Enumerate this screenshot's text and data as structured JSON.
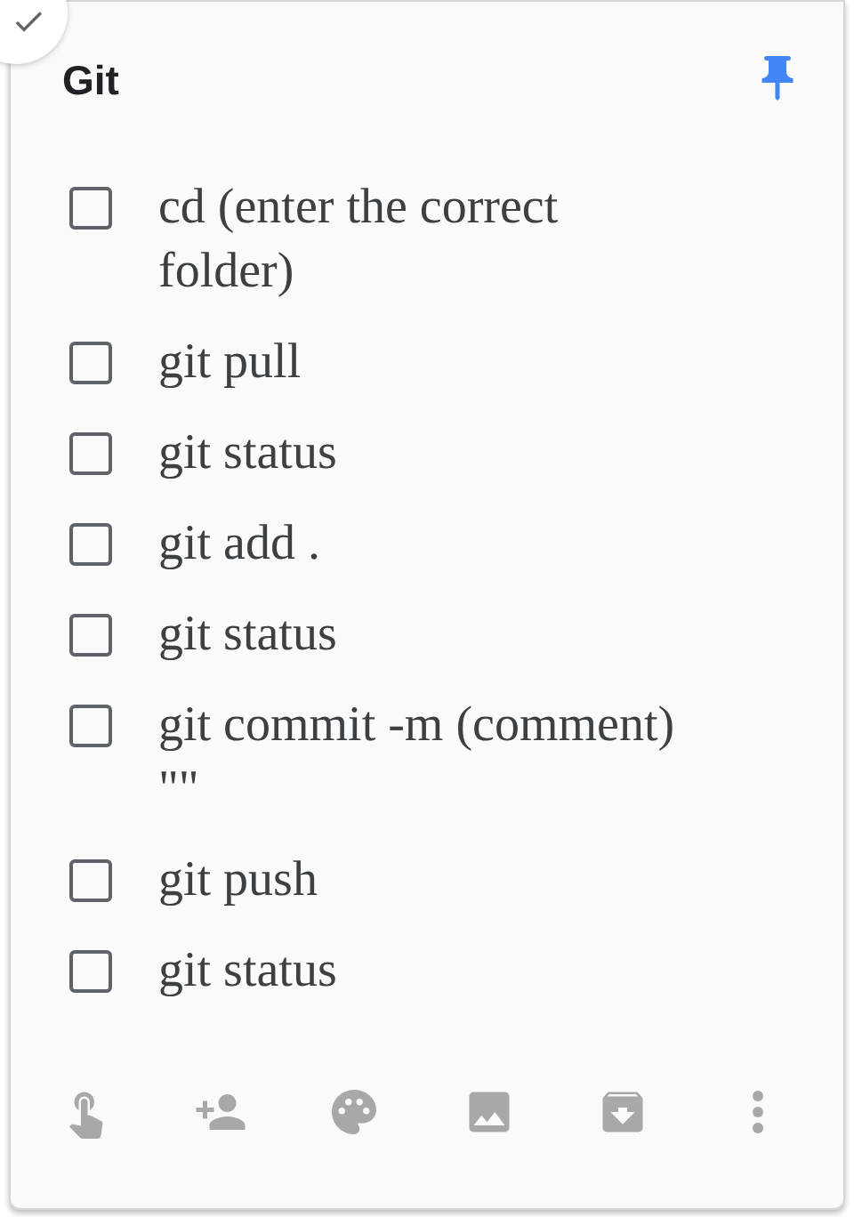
{
  "note": {
    "title": "Git",
    "pinned": true,
    "items": [
      {
        "text": "cd (enter the correct folder)",
        "checked": false
      },
      {
        "text": "git pull",
        "checked": false
      },
      {
        "text": "git status",
        "checked": false
      },
      {
        "text": "git add .",
        "checked": false
      },
      {
        "text": "git status",
        "checked": false
      },
      {
        "text": "git commit -m (comment) \"\"",
        "checked": false
      },
      {
        "text": "git push",
        "checked": false
      },
      {
        "text": "git status",
        "checked": false
      }
    ]
  }
}
